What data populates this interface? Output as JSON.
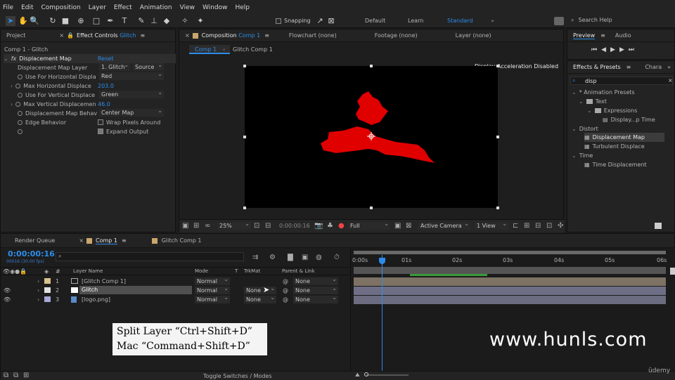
{
  "menu": [
    "File",
    "Edit",
    "Composition",
    "Layer",
    "Effect",
    "Animation",
    "View",
    "Window",
    "Help"
  ],
  "toolbar": {
    "snapping_label": "Snapping",
    "workspaces": [
      "Default",
      "Learn",
      "Standard"
    ],
    "active_workspace": "Standard",
    "search_placeholder": "Search Help"
  },
  "effect_controls": {
    "tabs": [
      "Project",
      "Effect Controls Glitch"
    ],
    "tab_name_prefix": "Effect Controls",
    "tab_name_layer": "Glitch",
    "comp_label": "Comp 1 - Glitch",
    "effect_name": "Displacement Map",
    "reset_label": "Reset",
    "rows": [
      {
        "label": "Displacement Map Layer",
        "value": "1. Glitch",
        "value2": "Source"
      },
      {
        "label": "Use For Horizontal Displa",
        "value": "Red"
      },
      {
        "label": "Max Horizontal Displace",
        "value": "203.0"
      },
      {
        "label": "Use For Vertical Displace",
        "value": "Green"
      },
      {
        "label": "Max Vertical Displacemen",
        "value": "46.0"
      },
      {
        "label": "Displacement Map Behav",
        "value": "Center Map"
      },
      {
        "label": "Edge Behavior",
        "value": "Wrap Pixels Around"
      },
      {
        "label": "",
        "value": "Expand Output"
      }
    ]
  },
  "composition": {
    "tabs": [
      "Composition Comp 1",
      "Flowchart (none)",
      "Footage (none)",
      "Layer (none)"
    ],
    "tab_comp_prefix": "Composition",
    "tab_comp_name": "Comp 1",
    "breadcrumbs": [
      "Comp 1",
      "Glitch Comp 1"
    ],
    "accel_notice": "Display Acceleration Disabled",
    "zoom": "25%",
    "timecode": "0:00:00:16",
    "resolution": "Full",
    "camera": "Active Camera",
    "view": "1 View"
  },
  "preview": {
    "tabs": [
      "Preview",
      "Audio"
    ]
  },
  "effects_presets": {
    "tabs": [
      "Effects & Presets",
      "Chara"
    ],
    "search_value": "disp",
    "tree": [
      {
        "label": "* Animation Presets",
        "depth": 0
      },
      {
        "label": "Text",
        "depth": 1
      },
      {
        "label": "Expressions",
        "depth": 2
      },
      {
        "label": "Display...p Time",
        "depth": 3
      },
      {
        "label": "Distort",
        "depth": 0
      },
      {
        "label": "Displacement Map",
        "depth": 1,
        "selected": true
      },
      {
        "label": "Turbulent Displace",
        "depth": 1
      },
      {
        "label": "Time",
        "depth": 0
      },
      {
        "label": "Time Displacement",
        "depth": 1
      }
    ]
  },
  "timeline": {
    "tabs": [
      "Render Queue",
      "Comp 1",
      "Glitch Comp 1"
    ],
    "timecode": "0:00:00:16",
    "frame_info": "00016 (30.00 fps)",
    "columns": {
      "layer_name": "Layer Name",
      "mode": "Mode",
      "t": "T",
      "trkmat": "TrkMat",
      "parent": "Parent & Link"
    },
    "ruler": [
      "0:00s",
      "01s",
      "02s",
      "03s",
      "04s",
      "05s",
      "06s"
    ],
    "layers": [
      {
        "num": "1",
        "name": "[Glitch Comp 1]",
        "mode": "Normal",
        "trkmat": "",
        "parent": "None",
        "color": "#d9c38c"
      },
      {
        "num": "2",
        "name": "Glitch",
        "mode": "Normal",
        "trkmat": "None",
        "parent": "None",
        "color": "#e0e0e0"
      },
      {
        "num": "3",
        "name": "[logo.png]",
        "mode": "Normal",
        "trkmat": "None",
        "parent": "None",
        "color": "#a8a8d8"
      }
    ],
    "toggle_label": "Toggle Switches / Modes"
  },
  "caption": {
    "line1": "Split Layer “Ctrl+Shift+D”",
    "line2": "Mac “Command+Shift+D”"
  },
  "watermark": "www.hunls.com",
  "brand": "ûdemy",
  "colors": {
    "accent": "#2d8ceb",
    "displacement_red": "#e00000"
  }
}
